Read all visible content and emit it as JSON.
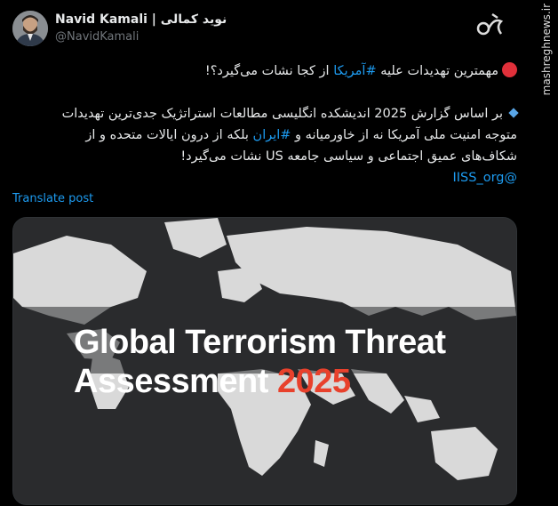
{
  "author": {
    "display_name": "Navid Kamali | نوید کمالی",
    "handle": "@NavidKamali"
  },
  "watermark": "mashreghnews.ir",
  "tweet": {
    "line1_prefix": "مهمترین تهدیدات علیه ",
    "line1_hashtag": "#آمریکا",
    "line1_suffix": " از کجا نشات می‌گیرد؟!",
    "para2_part1": "بر اساس گزارش 2025 اندیشکده انگلیسی مطالعات استراتژیک جدی‌ترین تهدیدات متوجه امنیت ملی آمریکا نه از خاورمیانه و ",
    "para2_hashtag": "#ایران",
    "para2_part2": " بلکه از درون ایالات متحده و از شکاف‌های عمیق اجتماعی و سیاسی جامعه US نشات می‌گیرد!",
    "mention": "@IISS_org"
  },
  "translate_label": "Translate post",
  "card": {
    "title_line1": "Global Terrorism Threat",
    "title_line2_prefix": "Assessment ",
    "title_year": "2025"
  },
  "colors": {
    "link": "#1d9bf0",
    "accent_red": "#e8412c",
    "background": "#000000"
  },
  "icons": [
    "avatar",
    "brand-logo-icon",
    "red-circle-icon",
    "blue-diamond-icon"
  ]
}
